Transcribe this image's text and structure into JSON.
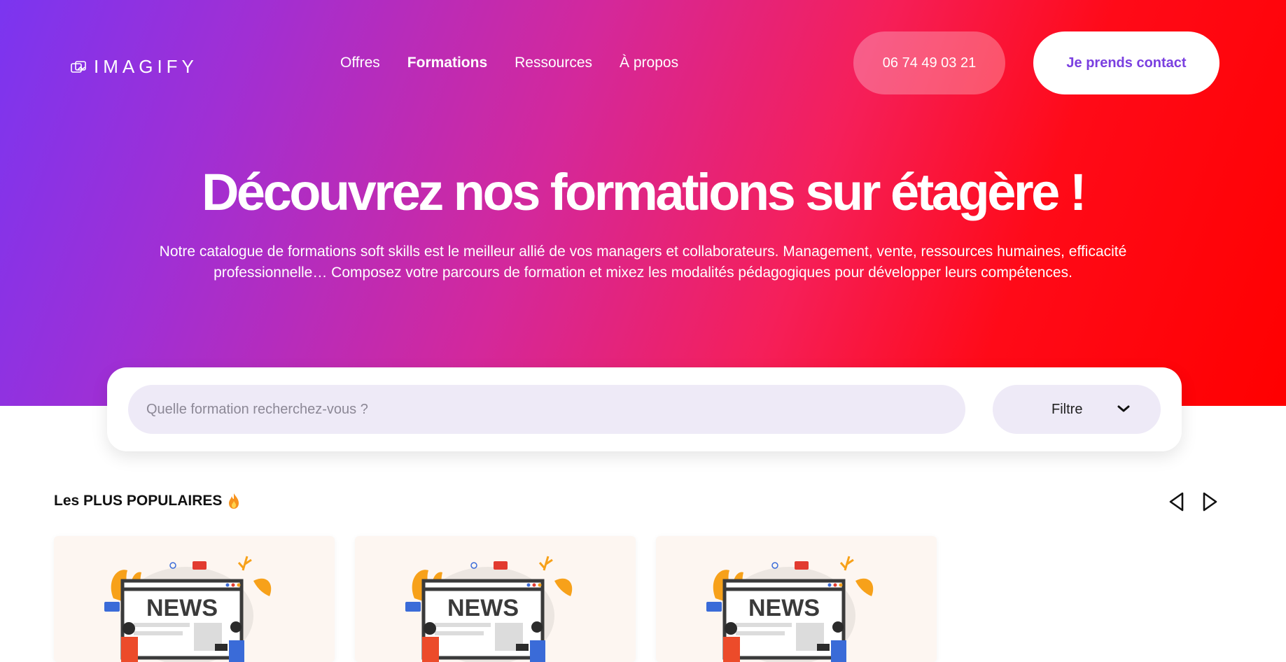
{
  "header": {
    "logo_text": "IMAGIFY",
    "nav": [
      {
        "label": "Offres",
        "active": false
      },
      {
        "label": "Formations",
        "active": true
      },
      {
        "label": "Ressources",
        "active": false
      },
      {
        "label": "À propos",
        "active": false
      }
    ],
    "phone_label": "06 74 49 03 21",
    "contact_label": "Je prends contact"
  },
  "hero": {
    "title": "Découvrez nos formations sur étagère !",
    "subtitle": "Notre catalogue de formations soft skills est le meilleur allié de vos managers et collaborateurs. Management, vente, ressources humaines, efficacité professionnelle… Composez votre parcours de formation et mixez les modalités pédagogiques pour développer leurs compétences."
  },
  "search": {
    "placeholder": "Quelle formation recherchez-vous ?",
    "value": "",
    "filter_label": "Filtre"
  },
  "popular": {
    "title": "Les PLUS POPULAIRES",
    "icon": "flame-icon",
    "cards": [
      {
        "image_text": "NEWS"
      },
      {
        "image_text": "NEWS"
      },
      {
        "image_text": "NEWS"
      }
    ]
  },
  "colors": {
    "gradient_start": "#7b35f0",
    "gradient_mid": "#d3289c",
    "gradient_end": "#ff0000",
    "accent_text": "#7a3fe0",
    "input_bg": "#eeeaf7"
  }
}
